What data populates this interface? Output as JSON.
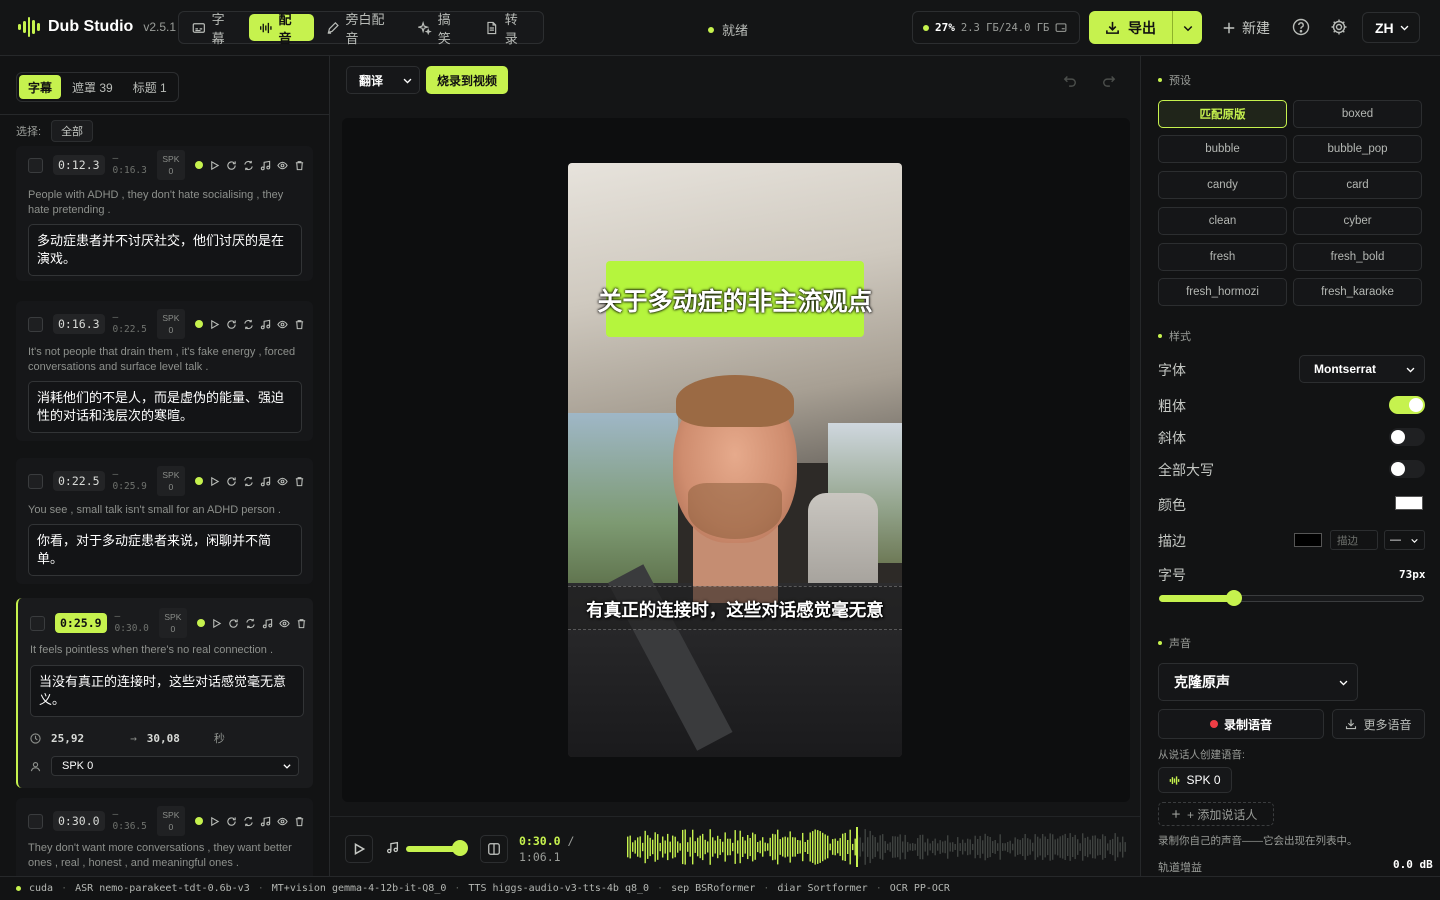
{
  "app": {
    "name": "Dub Studio",
    "version": "v2.5.1"
  },
  "modes": [
    {
      "label": "字幕",
      "icon": "subtitle-icon",
      "active": false
    },
    {
      "label": "配音",
      "icon": "waveform-icon",
      "active": true
    },
    {
      "label": "旁白配音",
      "icon": "pen-icon",
      "active": false
    },
    {
      "label": "搞笑",
      "icon": "sparkle-icon",
      "active": false
    },
    {
      "label": "转录",
      "icon": "document-icon",
      "active": false
    }
  ],
  "status": {
    "label": "就绪",
    "color": "#c6f24e"
  },
  "gpu": {
    "percent": "27%",
    "memory": "2.3 ГБ/24.0 ГБ"
  },
  "header": {
    "export_label": "导出",
    "new_label": "新建",
    "language": "ZH"
  },
  "left": {
    "tabs": [
      {
        "label": "字幕",
        "active": true
      },
      {
        "label": "遮罩 39",
        "active": false
      },
      {
        "label": "标题 1",
        "active": false
      }
    ],
    "select_label": "选择:",
    "select_all": "全部",
    "segments": [
      {
        "start": "0:12.3",
        "dash": "—",
        "end": "0:16.3",
        "spk_top": "SPK",
        "spk_bottom": "0",
        "original": "People with ADHD , they don't hate socialising , they hate pretending .",
        "translation": "多动症患者并不讨厌社交，他们讨厌的是在演戏。"
      },
      {
        "start": "0:16.3",
        "dash": "—",
        "end": "0:22.5",
        "spk_top": "SPK",
        "spk_bottom": "0",
        "original": "It's not people that drain them , it's fake energy , forced conversations and surface level talk .",
        "translation": "消耗他们的不是人，而是虚伪的能量、强迫性的对话和浅层次的寒暄。"
      },
      {
        "start": "0:22.5",
        "dash": "—",
        "end": "0:25.9",
        "spk_top": "SPK",
        "spk_bottom": "0",
        "original": "You see , small talk isn't small for an ADHD person .",
        "translation": "你看，对于多动症患者来说，闲聊并不简单。"
      },
      {
        "start": "0:25.9",
        "dash": "—",
        "end": "0:30.0",
        "spk_top": "SPK",
        "spk_bottom": "0",
        "original": "It feels pointless when there's no real connection .",
        "translation": "当没有真正的连接时，这些对话感觉毫无意义。",
        "time_from": "25,92",
        "time_to": "30,08",
        "time_unit": "秒",
        "speaker": "SPK 0"
      },
      {
        "start": "0:30.0",
        "dash": "—",
        "end": "0:36.5",
        "spk_top": "SPK",
        "spk_bottom": "0",
        "original": "They don't want more conversations , they want better ones , real , honest , and meaningful ones ."
      }
    ]
  },
  "center": {
    "mode_select": "翻译",
    "burn_label": "烧录到视频",
    "video_title": "关于多动症的非主流观点",
    "video_subtitle": "有真正的连接时，这些对话感觉毫无意",
    "time_current": "0:30.0",
    "time_sep": "/",
    "time_total": "1:06.1",
    "volume": 0.85,
    "playhead_fraction": 0.46
  },
  "right": {
    "presets_title": "预设",
    "presets": [
      {
        "label": "匹配原版",
        "active": true
      },
      {
        "label": "boxed"
      },
      {
        "label": "bubble"
      },
      {
        "label": "bubble_pop"
      },
      {
        "label": "candy"
      },
      {
        "label": "card"
      },
      {
        "label": "clean"
      },
      {
        "label": "cyber"
      },
      {
        "label": "fresh"
      },
      {
        "label": "fresh_bold"
      },
      {
        "label": "fresh_hormozi"
      },
      {
        "label": "fresh_karaoke"
      }
    ],
    "style_title": "样式",
    "font_label": "字体",
    "font_value": "Montserrat",
    "bold_label": "粗体",
    "bold_on": true,
    "italic_label": "斜体",
    "italic_on": false,
    "caps_label": "全部大写",
    "caps_on": false,
    "color_label": "颜色",
    "color_value": "#ffffff",
    "stroke_label": "描边",
    "stroke_color": "#000000",
    "stroke_placeholder": "描边",
    "stroke_select": "—",
    "size_label": "字号",
    "size_value": "73px",
    "size_fraction": 0.28,
    "voice_title": "声音",
    "voice_select": "克隆原声",
    "record_label": "录制语音",
    "more_voices_label": "更多语音",
    "create_from_speaker": "从说话人创建语音:",
    "speaker_chip": "SPK 0",
    "add_speaker": "+ 添加说话人",
    "record_hint": "录制你自己的声音——它会出现在列表中。",
    "gain_label": "轨道增益",
    "gain_value": "0.0 dB"
  },
  "statusbar": [
    "cuda",
    "ASR nemo-parakeet-tdt-0.6b-v3",
    "MT+vision gemma-4-12b-it-Q8_0",
    "TTS higgs-audio-v3-tts-4b q8_0",
    "sep BSRoformer",
    "diar Sortformer",
    "OCR PP-OCR"
  ]
}
